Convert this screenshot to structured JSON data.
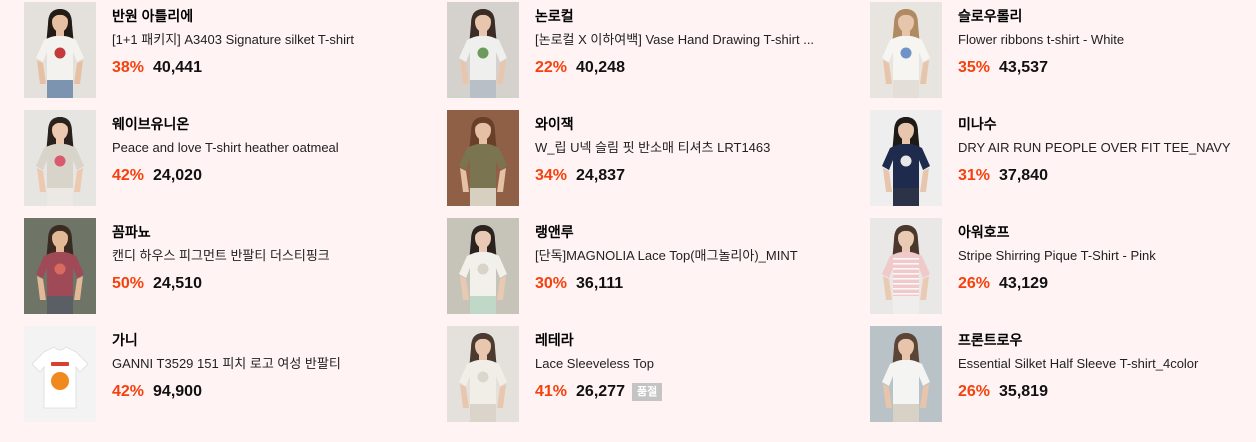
{
  "colors": {
    "background": "#fff3f3",
    "discount": "#f5410e",
    "price": "#111111",
    "badge_bg": "#c4c4c4",
    "badge_text": "#ffffff"
  },
  "products": [
    {
      "brand": "반원 아틀리에",
      "name": "[1+1 패키지] A3403 Signature silket T-shirt",
      "discount": "38%",
      "price": "40,441",
      "thumb": {
        "bg": "#e4e1dc",
        "skin": "#e7c0a3",
        "hair": "#231b16",
        "shirt": "#f4f2ee",
        "accent": "#c33a3c",
        "bottom": "#7d94b0"
      }
    },
    {
      "brand": "웨이브유니온",
      "name": "Peace and love T-shirt heather oatmeal",
      "discount": "42%",
      "price": "24,020",
      "thumb": {
        "bg": "#e6e5e1",
        "skin": "#ecc9b0",
        "hair": "#2b221d",
        "shirt": "#d9d4ca",
        "accent": "#d95a6f",
        "bottom": "#ece9e4"
      }
    },
    {
      "brand": "꼼파뇨",
      "name": "캔디 하우스 피그먼트 반팔티 더스티핑크",
      "discount": "50%",
      "price": "24,510",
      "thumb": {
        "bg": "#6e7566",
        "skin": "#e3b896",
        "hair": "#3a2b22",
        "shirt": "#a04a58",
        "accent": "#d96a5f",
        "bottom": "#5a5f66"
      }
    },
    {
      "brand": "가니",
      "name": "GANNI T3529 151 피치 로고 여성 반팔티",
      "discount": "42%",
      "price": "94,900",
      "thumb": {
        "bg": "#f3f3f3",
        "shirt": "#ffffff",
        "accent": "#f08a1d",
        "accent2": "#d9402f"
      }
    },
    {
      "brand": "논로컬",
      "name": "[논로컬 X 이하여백] Vase Hand Drawing T-shirt ...",
      "discount": "22%",
      "price": "40,248",
      "thumb": {
        "bg": "#d5d2ce",
        "skin": "#e8c6ad",
        "hair": "#3b2d25",
        "shirt": "#efefee",
        "accent": "#6c9a5e",
        "bottom": "#b9bfc6"
      }
    },
    {
      "brand": "와이잭",
      "name": "W_립 U넥 슬림 핏 반소매 티셔츠 LRT1463",
      "discount": "34%",
      "price": "24,837",
      "thumb": {
        "bg": "#8f5f46",
        "skin": "#e6c0a4",
        "hair": "#6a3f2a",
        "shirt": "#7a7550",
        "bottom": "#d7cfc0"
      }
    },
    {
      "brand": "랭앤루",
      "name": "[단독]MAGNOLIA Lace Top(매그놀리아)_MINT",
      "discount": "30%",
      "price": "36,111",
      "thumb": {
        "bg": "#c6c4b8",
        "skin": "#e9c9b3",
        "hair": "#2b2320",
        "shirt": "#f2f0ea",
        "accent": "#d8d4c8",
        "bottom": "#bfd8c8"
      }
    },
    {
      "brand": "레테라",
      "name": "Lace Sleeveless Top",
      "discount": "41%",
      "price": "26,277",
      "badge": "품절",
      "thumb": {
        "bg": "#e4e1dc",
        "skin": "#e9c6ae",
        "hair": "#4a3a30",
        "shirt": "#f1eee8",
        "accent": "#dcd7cd",
        "bottom": "#dad4ca"
      }
    },
    {
      "brand": "슬로우롤리",
      "name": "Flower ribbons t-shirt - White",
      "discount": "35%",
      "price": "43,537",
      "thumb": {
        "bg": "#e8e5e1",
        "skin": "#e7c5ab",
        "hair": "#b08a62",
        "shirt": "#f6f5f2",
        "accent": "#6f93c9",
        "bottom": "#e3ded7"
      }
    },
    {
      "brand": "미나수",
      "name": "DRY AIR RUN PEOPLE OVER FIT TEE_NAVY",
      "discount": "31%",
      "price": "37,840",
      "thumb": {
        "bg": "#eeeeee",
        "skin": "#e8c5ad",
        "hair": "#1e1a18",
        "shirt": "#1f2b4d",
        "accent": "#e8e8e8",
        "bottom": "#2c3346"
      }
    },
    {
      "brand": "아워호프",
      "name": "Stripe Shirring Pique T-Shirt - Pink",
      "discount": "26%",
      "price": "43,129",
      "thumb": {
        "bg": "#e9e8e6",
        "skin": "#ebcab3",
        "hair": "#4a382c",
        "shirt": "#f0c9cb",
        "stripe": "#ffffff",
        "bottom": "#efeeec"
      }
    },
    {
      "brand": "프론트로우",
      "name": "Essential Silket Half Sleeve T-shirt_4color",
      "discount": "26%",
      "price": "35,819",
      "thumb": {
        "bg": "#b8c2c7",
        "skin": "#e7c4aa",
        "hair": "#5a4537",
        "shirt": "#f4f4f2",
        "bottom": "#d8d2c6"
      }
    }
  ]
}
